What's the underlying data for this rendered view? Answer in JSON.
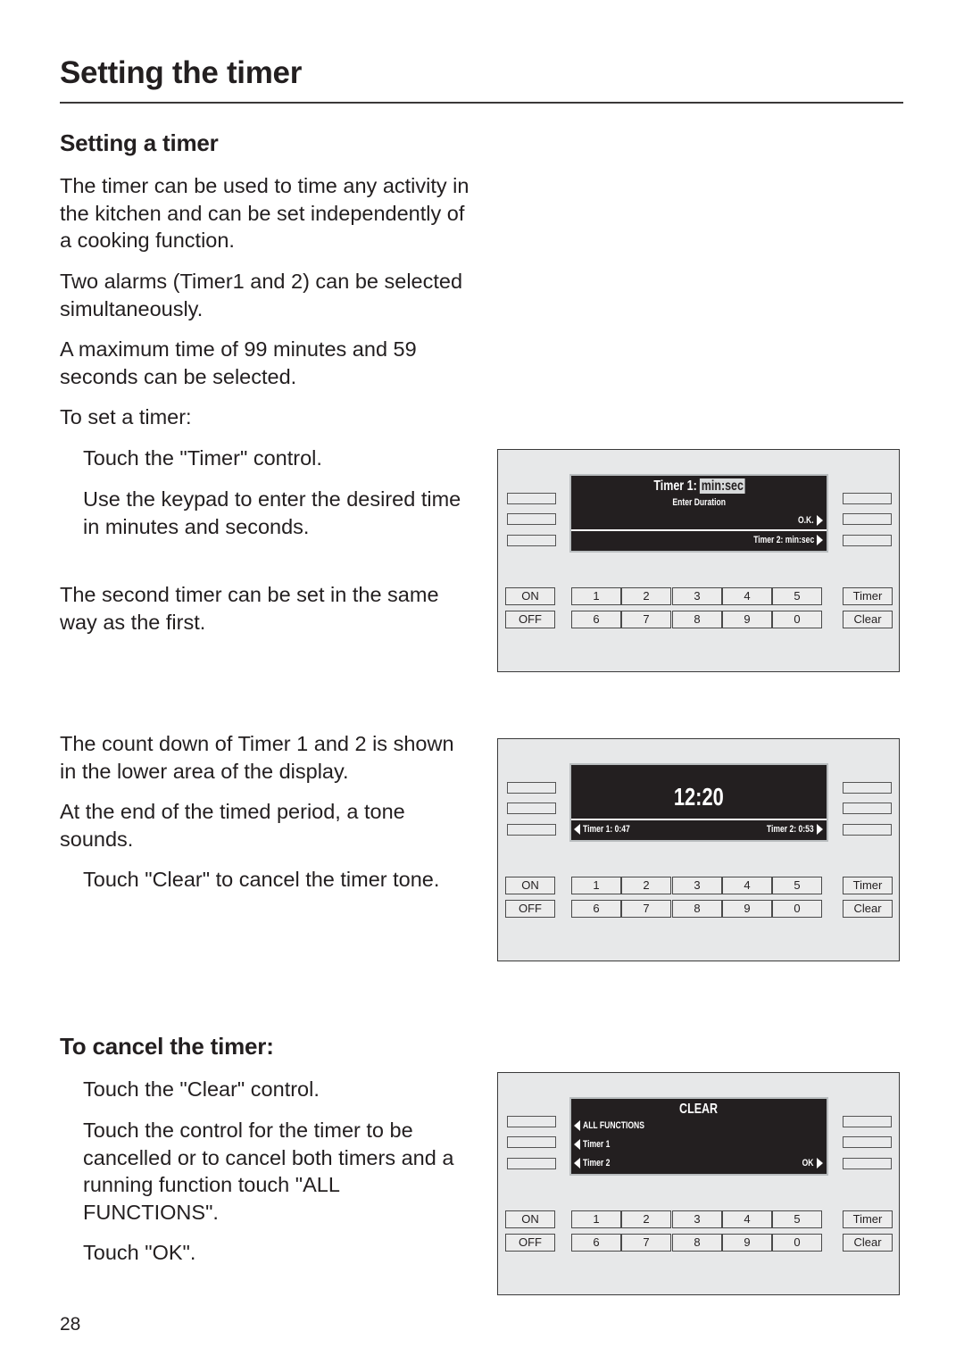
{
  "page": {
    "title": "Setting the timer",
    "page_number": "28"
  },
  "section_setting": {
    "heading": "Setting a timer",
    "paragraphs": [
      "The timer can be used to time any activity in the kitchen and can be set independently of a cooking function.",
      "Two alarms (Timer1 and 2) can be selected simultaneously.",
      "A maximum time of 99 minutes and 59 seconds can be selected.",
      "To set a timer:"
    ],
    "steps": [
      "Touch the \"Timer\" control.",
      "Use the keypad to enter the desired time in minutes and seconds."
    ],
    "note": "The second timer can be set in the same way as the first.",
    "countdown_paragraphs": [
      "The count down of Timer 1 and 2 is shown in the lower area of the display.",
      "At the end of the timed period, a tone sounds."
    ],
    "countdown_step": "Touch \"Clear\" to cancel the timer tone."
  },
  "section_cancel": {
    "heading": "To cancel the timer:",
    "steps": [
      "Touch the \"Clear\" control.",
      "Touch the control for the timer to be cancelled or to cancel both timers and a running function touch \"ALL FUNCTIONS\".",
      "Touch \"OK\"."
    ]
  },
  "keypad": {
    "on": "ON",
    "off": "OFF",
    "digits_top": [
      "1",
      "2",
      "3",
      "4",
      "5"
    ],
    "digits_bottom": [
      "6",
      "7",
      "8",
      "9",
      "0"
    ],
    "timer": "Timer",
    "clear": "Clear"
  },
  "panels": {
    "enter": {
      "title_prefix": "Timer 1:",
      "title_field": "min:sec",
      "subtitle": "Enter Duration",
      "ok": "O.K.",
      "timer2": "Timer 2: min:sec"
    },
    "countdown": {
      "clock": "12:20",
      "timer1": "Timer 1: 0:47",
      "timer2": "Timer 2: 0:53"
    },
    "clear": {
      "title": "CLEAR",
      "all_functions": "ALL FUNCTIONS",
      "timer1": "Timer  1",
      "timer2": "Timer  2",
      "ok": "OK"
    }
  }
}
